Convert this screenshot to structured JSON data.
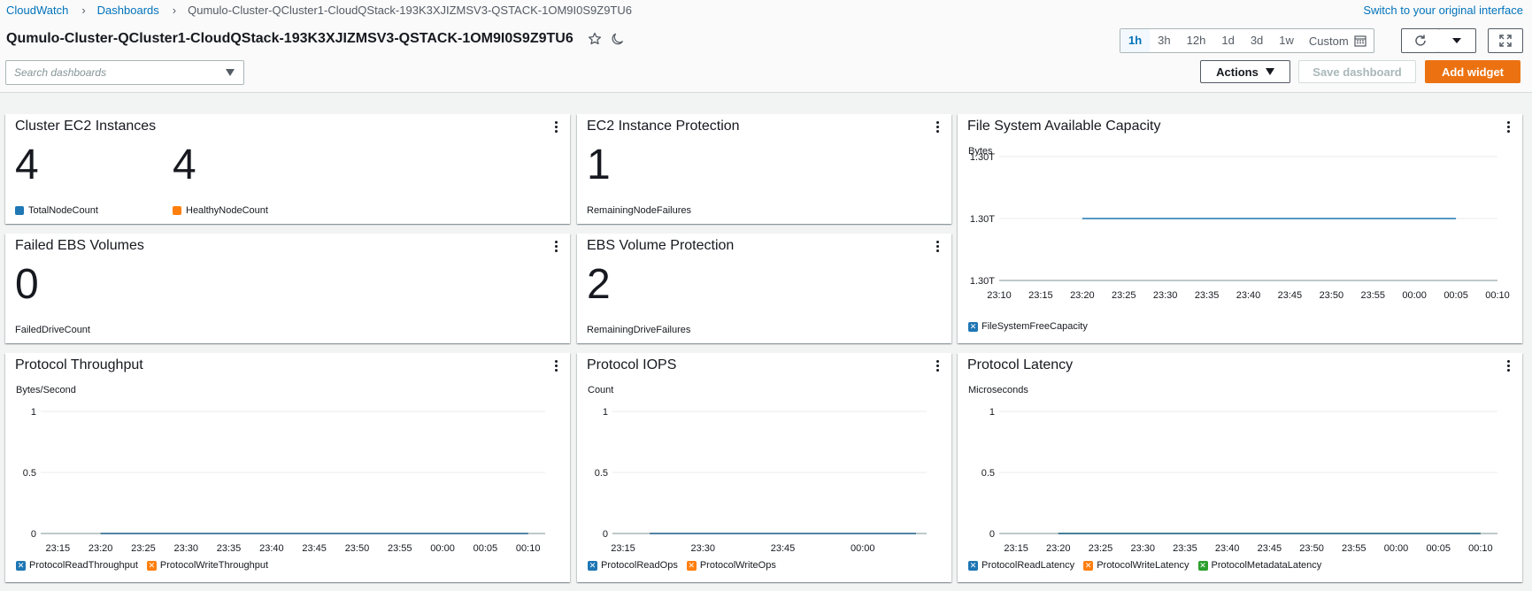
{
  "breadcrumb": {
    "items": [
      "CloudWatch",
      "Dashboards",
      "Qumulo-Cluster-QCluster1-CloudQStack-193K3XJIZMSV3-QSTACK-1OM9I0S9Z9TU6"
    ]
  },
  "header": {
    "switch_link": "Switch to your original interface",
    "title": "Qumulo-Cluster-QCluster1-CloudQStack-193K3XJIZMSV3-QSTACK-1OM9I0S9Z9TU6",
    "time_ranges": [
      "1h",
      "3h",
      "12h",
      "1d",
      "3d",
      "1w"
    ],
    "active_range": "1h",
    "custom_label": "Custom"
  },
  "toolbar": {
    "search_placeholder": "Search dashboards",
    "actions_label": "Actions",
    "save_label": "Save dashboard",
    "add_widget_label": "Add widget"
  },
  "colors": {
    "blue": "#1f77b4",
    "orange": "#ff7f0e",
    "green": "#2ca02c",
    "accent": "#ec7211",
    "link": "#0073bb"
  },
  "widgets": {
    "cluster_ec2": {
      "title": "Cluster EC2 Instances",
      "metrics": [
        {
          "value": "4",
          "label": "TotalNodeCount"
        },
        {
          "value": "4",
          "label": "HealthyNodeCount"
        }
      ]
    },
    "ec2_protection": {
      "title": "EC2 Instance Protection",
      "value": "1",
      "label": "RemainingNodeFailures"
    },
    "failed_ebs": {
      "title": "Failed EBS Volumes",
      "value": "0",
      "label": "FailedDriveCount"
    },
    "ebs_protection": {
      "title": "EBS Volume Protection",
      "value": "2",
      "label": "RemainingDriveFailures"
    },
    "fs_capacity": {
      "title": "File System Available Capacity",
      "unit": "Bytes"
    },
    "throughput": {
      "title": "Protocol Throughput",
      "unit": "Bytes/Second"
    },
    "iops": {
      "title": "Protocol IOPS",
      "unit": "Count"
    },
    "latency": {
      "title": "Protocol Latency",
      "unit": "Microseconds"
    }
  },
  "chart_data": [
    {
      "id": "fs_capacity",
      "type": "line",
      "title": "File System Available Capacity",
      "ylabel": "Bytes",
      "y_ticks": [
        "1.30T",
        "1.30T",
        "1.30T"
      ],
      "x": [
        "23:10",
        "23:15",
        "23:20",
        "23:25",
        "23:30",
        "23:35",
        "23:40",
        "23:45",
        "23:50",
        "23:55",
        "00:00",
        "00:05",
        "00:10"
      ],
      "series": [
        {
          "name": "FileSystemFreeCapacity",
          "color": "#1f77b4",
          "x_range": [
            "23:20",
            "00:05"
          ],
          "value": "1.30T"
        }
      ]
    },
    {
      "id": "throughput",
      "type": "line",
      "title": "Protocol Throughput",
      "ylabel": "Bytes/Second",
      "y_ticks": [
        "1",
        "0.5",
        "0"
      ],
      "ylim": [
        0,
        1
      ],
      "x": [
        "23:15",
        "23:20",
        "23:25",
        "23:30",
        "23:35",
        "23:40",
        "23:45",
        "23:50",
        "23:55",
        "00:00",
        "00:05",
        "00:10"
      ],
      "series": [
        {
          "name": "ProtocolReadThroughput",
          "color": "#1f77b4",
          "x_range": [
            "23:20",
            "00:10"
          ],
          "value": 0
        },
        {
          "name": "ProtocolWriteThroughput",
          "color": "#ff7f0e",
          "x_range": [
            "23:20",
            "00:10"
          ],
          "value": 0
        }
      ]
    },
    {
      "id": "iops",
      "type": "line",
      "title": "Protocol IOPS",
      "ylabel": "Count",
      "y_ticks": [
        "1",
        "0.5",
        "0"
      ],
      "ylim": [
        0,
        1
      ],
      "x": [
        "23:15",
        "23:30",
        "23:45",
        "00:00"
      ],
      "series": [
        {
          "name": "ProtocolReadOps",
          "color": "#1f77b4",
          "x_range": [
            "23:20",
            "00:10"
          ],
          "value": 0
        },
        {
          "name": "ProtocolWriteOps",
          "color": "#ff7f0e",
          "x_range": [
            "23:20",
            "00:10"
          ],
          "value": 0
        }
      ]
    },
    {
      "id": "latency",
      "type": "line",
      "title": "Protocol Latency",
      "ylabel": "Microseconds",
      "y_ticks": [
        "1",
        "0.5",
        "0"
      ],
      "ylim": [
        0,
        1
      ],
      "x": [
        "23:15",
        "23:20",
        "23:25",
        "23:30",
        "23:35",
        "23:40",
        "23:45",
        "23:50",
        "23:55",
        "00:00",
        "00:05",
        "00:10"
      ],
      "series": [
        {
          "name": "ProtocolReadLatency",
          "color": "#1f77b4",
          "x_range": [
            "23:20",
            "00:10"
          ],
          "value": 0
        },
        {
          "name": "ProtocolWriteLatency",
          "color": "#ff7f0e",
          "x_range": [
            "23:20",
            "00:10"
          ],
          "value": 0
        },
        {
          "name": "ProtocolMetadataLatency",
          "color": "#2ca02c",
          "x_range": [
            "23:20",
            "00:10"
          ],
          "value": 0
        }
      ]
    }
  ]
}
